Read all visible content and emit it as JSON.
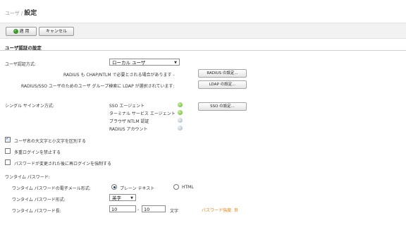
{
  "breadcrumb": {
    "parent": "ユーザ",
    "separator": "/",
    "current": "設定"
  },
  "toolbar": {
    "apply_label": "適 用",
    "cancel_label": "キャンセル"
  },
  "section": {
    "title": "ユーザ認証の設定"
  },
  "auth_method": {
    "label": "ユーザ認証方式:",
    "selected": "ローカル ユーザ"
  },
  "radius": {
    "note": "RADIUS も CHAP/NTLM で必要とされる場合があります -",
    "button": "RADIUS の設定..."
  },
  "ldap": {
    "note": "RADIUS/SSO ユーザのためのユーザ グループ検索に LDAP が選択されています:",
    "button": "LDAP の設定..."
  },
  "sso": {
    "label": "シングル サインオン方式:",
    "button": "SSO の設定...",
    "methods": [
      {
        "label": "SSO エージェント",
        "status": "green"
      },
      {
        "label": "ターミナル サービス エージェント",
        "status": "green"
      },
      {
        "label": "ブラウザ NTLM 認証",
        "status": "gray"
      },
      {
        "label": "RADIUS アカウント",
        "status": "gray"
      }
    ]
  },
  "options": {
    "case_sensitive": {
      "label": "ユーザ名の大文字と小文字を区別する",
      "checked": true
    },
    "no_multi_login": {
      "label": "多重ログインを禁止する",
      "checked": false
    },
    "force_relogin": {
      "label": "パスワードが変更された後に再ログインを強制する",
      "checked": false
    }
  },
  "otp": {
    "heading": "ワンタイム パスワード:",
    "email_format_label": "ワンタイム パスワードの電子メール形式:",
    "format_plain": "プレーン テキスト",
    "format_html": "HTML",
    "selected_format": "plain",
    "pw_format_label": "ワンタイム パスワード形式:",
    "pw_format_value": "英字",
    "length_label": "ワンタイム パスワード長:",
    "length_min": "10",
    "length_sep": "-",
    "length_max": "10",
    "length_unit": "文字",
    "strength": "パスワード強度: 良"
  },
  "colors": {
    "accent_orange": "#e08218",
    "status_green": "#64b32d",
    "status_gray": "#a7b4c2"
  }
}
